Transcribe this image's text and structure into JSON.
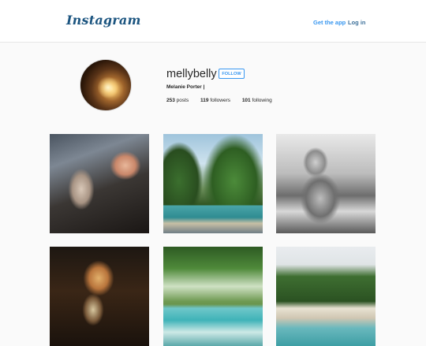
{
  "header": {
    "logo_text": "Instagram",
    "get_app_label": "Get the app",
    "login_label": "Log in"
  },
  "profile": {
    "username": "mellybelly",
    "follow_label": "FOLLOW",
    "full_name": "Melanie Porter |",
    "posts_count": "253",
    "posts_label": "posts",
    "followers_count": "119",
    "followers_label": "followers",
    "following_count": "101",
    "following_label": "following"
  },
  "colors": {
    "link_blue": "#3897f0",
    "brand_blue": "#3f729b",
    "background": "#fafafa"
  },
  "posts": [
    "photo",
    "photo",
    "photo",
    "photo",
    "photo",
    "photo"
  ]
}
